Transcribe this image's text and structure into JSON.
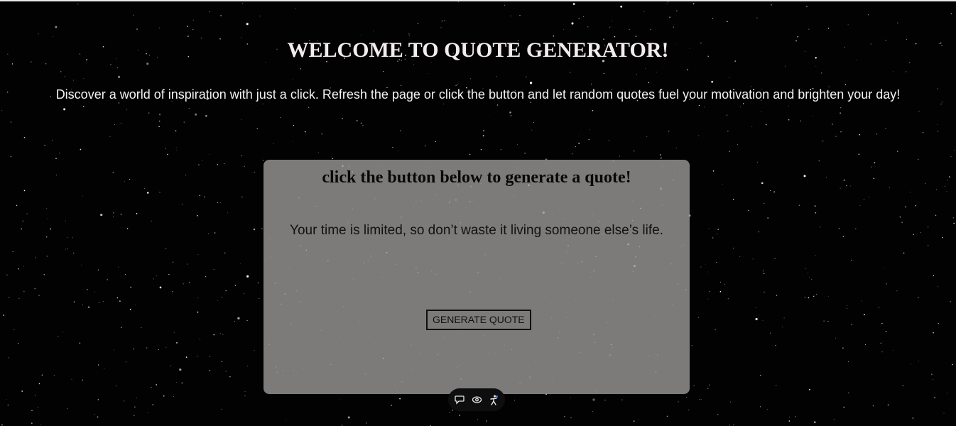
{
  "header": {
    "title": "WELCOME TO QUOTE GENERATOR!",
    "intro": "Discover a world of inspiration with just a click. Refresh the page or click the button and let random quotes fuel your motivation and brighten your day!"
  },
  "quote_card": {
    "heading": "click the button below to generate a quote!",
    "quote": "Your time is limited, so don’t waste it living someone else’s life.",
    "button_label": "GENERATE QUOTE"
  },
  "floating_toolbar": {
    "icons": [
      "chat-bubble-icon",
      "eye-icon",
      "accessibility-icon"
    ]
  },
  "colors": {
    "background": "#020202",
    "title_text": "#f2ecec",
    "card_background": "#878383",
    "card_text": "#111111"
  }
}
